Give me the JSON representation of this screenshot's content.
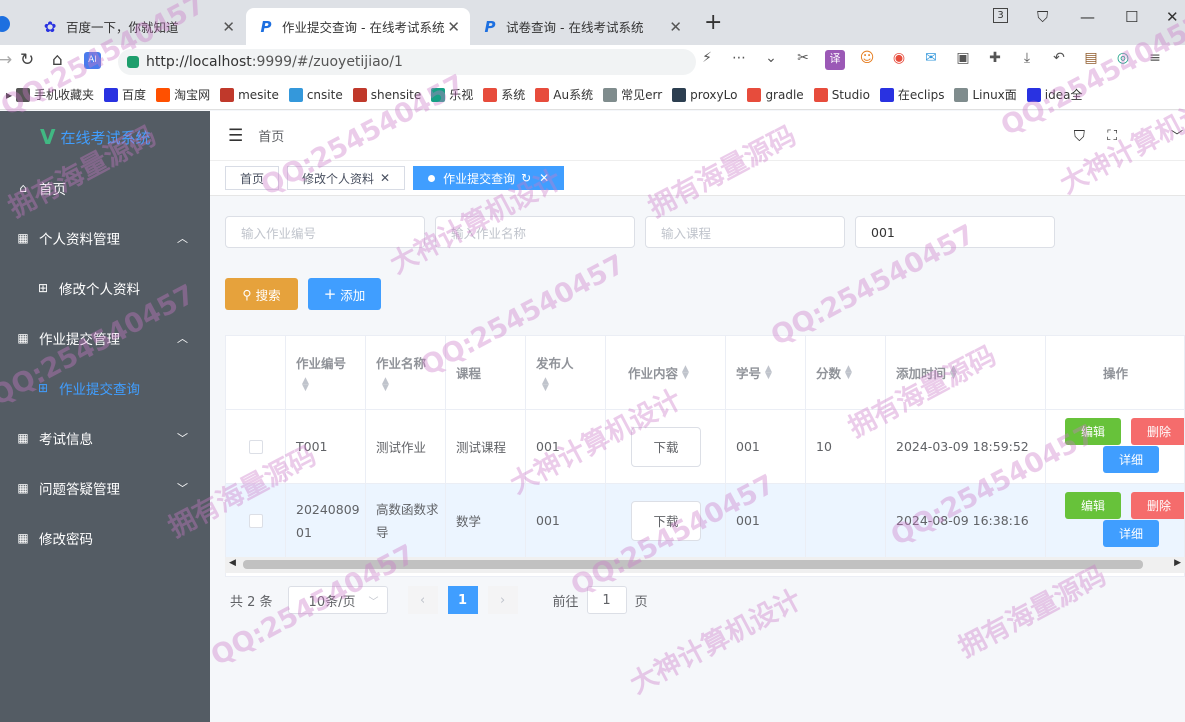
{
  "browser": {
    "tabs": [
      {
        "title": "百度一下，你就知道",
        "active": false
      },
      {
        "title": "作业提交查询 - 在线考试系统",
        "active": true
      },
      {
        "title": "试卷查询 - 在线考试系统",
        "active": false
      }
    ],
    "new_tab": "+",
    "tab_count": "3",
    "url_host": "http://localhost",
    "url_path": ":9999/#/zuoyetijiao/1",
    "bookmarks": [
      "手机收藏夹",
      "百度",
      "淘宝网",
      "mesite",
      "cnsite",
      "shensite",
      "乐视",
      "系统",
      "Au系统",
      "常见err",
      "proxyLo",
      "gradle",
      "Studio",
      "在eclips",
      "Linux面",
      "idea全"
    ]
  },
  "sidebar": {
    "title": "在线考试系统",
    "items": [
      {
        "label": "首页",
        "icon": "home-icon"
      },
      {
        "label": "个人资料管理",
        "icon": "grid-icon",
        "arrow": "up"
      },
      {
        "label": "修改个人资料",
        "icon": "apps-icon",
        "sub": true
      },
      {
        "label": "作业提交管理",
        "icon": "grid-icon",
        "arrow": "up"
      },
      {
        "label": "作业提交查询",
        "icon": "apps-icon",
        "sub": true,
        "active": true
      },
      {
        "label": "考试信息",
        "icon": "grid-icon",
        "arrow": "down"
      },
      {
        "label": "问题答疑管理",
        "icon": "grid-icon",
        "arrow": "down"
      },
      {
        "label": "修改密码",
        "icon": "grid-icon"
      }
    ]
  },
  "header": {
    "breadcrumb": "首页"
  },
  "tags": [
    {
      "label": "首页"
    },
    {
      "label": "修改个人资料"
    },
    {
      "label": "作业提交查询"
    }
  ],
  "search": {
    "homework_no_placeholder": "输入作业编号",
    "homework_name_placeholder": "输入作业名称",
    "course_placeholder": "输入课程",
    "student_value": "001",
    "search_label": "搜索",
    "add_label": "添加"
  },
  "table": {
    "headers": [
      "作业编号",
      "作业名称",
      "课程",
      "发布人",
      "作业内容",
      "学号",
      "分数",
      "添加时间",
      "操作"
    ],
    "download_label": "下载",
    "edit_label": "编辑",
    "delete_label": "删除",
    "detail_label": "详细",
    "rows": [
      {
        "no": "T001",
        "name": "测试作业",
        "course": "测试课程",
        "publisher": "001",
        "student_id": "001",
        "score": "10",
        "time": "2024-03-09 18:59:52"
      },
      {
        "no": "2024080901",
        "name": "高数函数求导",
        "course": "数学",
        "publisher": "001",
        "student_id": "001",
        "score": "",
        "time": "2024-08-09 16:38:16"
      }
    ]
  },
  "pagination": {
    "total": "共 2 条",
    "page_size": "10条/页",
    "current": "1",
    "goto_label": "前往",
    "goto_value": "1",
    "page_unit": "页"
  },
  "watermarks": [
    "QQ:254540457",
    "大神计算机设计",
    "拥有海量源码"
  ],
  "colors": {
    "primary": "#409eff",
    "sidebar": "#545c64",
    "success": "#67c23a",
    "danger": "#f56c6c",
    "warning": "#e6a23c"
  }
}
